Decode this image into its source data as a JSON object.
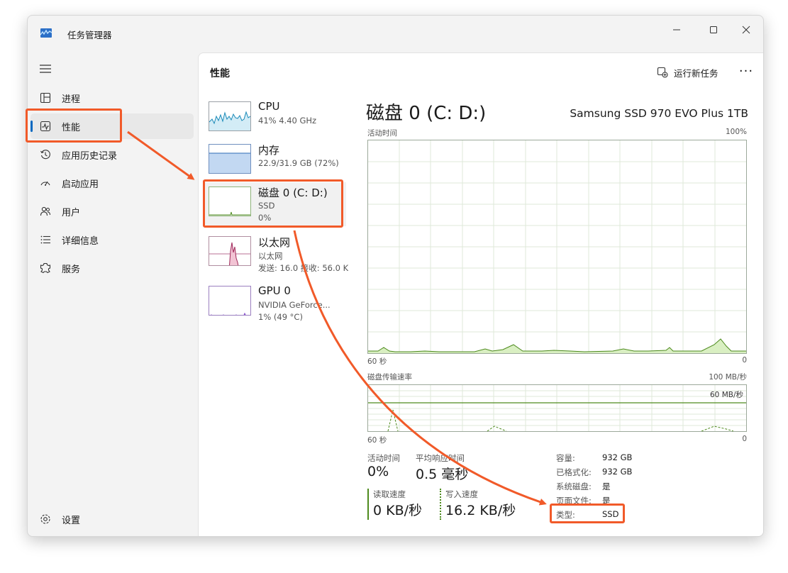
{
  "app": {
    "title": "任务管理器"
  },
  "sidebar": {
    "items": [
      {
        "label": "进程",
        "icon": "processes-icon"
      },
      {
        "label": "性能",
        "icon": "performance-icon",
        "active": true
      },
      {
        "label": "应用历史记录",
        "icon": "app-history-icon"
      },
      {
        "label": "启动应用",
        "icon": "startup-apps-icon"
      },
      {
        "label": "用户",
        "icon": "users-icon"
      },
      {
        "label": "详细信息",
        "icon": "details-icon"
      },
      {
        "label": "服务",
        "icon": "services-icon"
      }
    ],
    "settings_label": "设置"
  },
  "header": {
    "title": "性能",
    "run_task_label": "运行新任务",
    "more_label": "···"
  },
  "perf_list": [
    {
      "name": "CPU",
      "line2": "41% 4.40 GHz",
      "line3": ""
    },
    {
      "name": "内存",
      "line2": "22.9/31.9 GB (72%)",
      "line3": ""
    },
    {
      "name": "磁盘 0 (C: D:)",
      "line2": "SSD",
      "line3": "0%"
    },
    {
      "name": "以太网",
      "line2": "以太网",
      "line3": "发送: 16.0  接收: 56.0 K"
    },
    {
      "name": "GPU 0",
      "line2": "NVIDIA GeForce...",
      "line3": "1% (49 °C)"
    }
  ],
  "detail": {
    "title": "磁盘 0 (C: D:)",
    "model": "Samsung SSD 970 EVO Plus 1TB",
    "activity_graph": {
      "label": "活动时间",
      "max": "100%",
      "x_left": "60 秒",
      "x_right": "0"
    },
    "transfer_graph": {
      "label": "磁盘传输速率",
      "max": "100 MB/秒",
      "line_label": "60 MB/秒",
      "x_left": "60 秒",
      "x_right": "0"
    },
    "stats": {
      "active_time_label": "活动时间",
      "active_time_value": "0%",
      "response_label": "平均响应时间",
      "response_value": "0.5 毫秒",
      "read_label": "读取速度",
      "read_value": "0 KB/秒",
      "write_label": "写入速度",
      "write_value": "16.2 KB/秒"
    },
    "properties": [
      {
        "key": "容量:",
        "value": "932 GB"
      },
      {
        "key": "已格式化:",
        "value": "932 GB"
      },
      {
        "key": "系统磁盘:",
        "value": "是"
      },
      {
        "key": "页面文件:",
        "value": "是"
      },
      {
        "key": "类型:",
        "value": "SSD"
      }
    ]
  },
  "colors": {
    "accent": "#0067c0",
    "annotation": "#f15a29",
    "disk_graph": "#4d8a1d",
    "disk_fill": "#d9efc2"
  }
}
